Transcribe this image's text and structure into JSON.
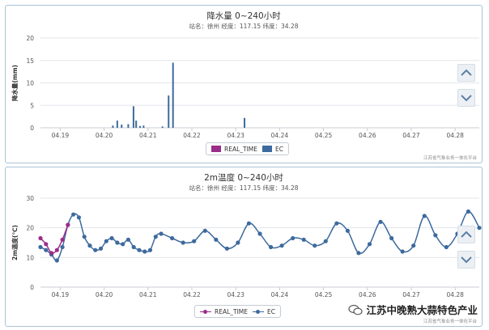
{
  "colors": {
    "ec": "#3d6a9e",
    "real_time": "#9b2d8a",
    "grid": "#e2e6ea",
    "axis_text": "#555555",
    "button_bg": "#ecf0f4",
    "button_icon": "#5b7fa6"
  },
  "x_ticks": [
    "04.19",
    "04.20",
    "04.21",
    "04.22",
    "04.23",
    "04.24",
    "04.25",
    "04.26",
    "04.27",
    "04.28"
  ],
  "legend": {
    "real_time": "REAL_TIME",
    "ec": "EC"
  },
  "credit": "江苏省气象业务一体化平台",
  "watermark": "江苏中晚熟大蒜特色产业",
  "nav": {
    "up_icon": "chevron-up-icon",
    "down_icon": "chevron-down-icon"
  },
  "chart_data": [
    {
      "type": "bar",
      "title": "降水量 0~240小时",
      "subtitle": "站名：徐州 经度：117.15 纬度：34.28",
      "ylabel": "降水量(mm)",
      "ylim": [
        0,
        20
      ],
      "yticks": [
        0,
        5,
        10,
        15,
        20
      ],
      "xlim_days": [
        0,
        10
      ],
      "x_tick_labels": [
        "04.19",
        "04.20",
        "04.21",
        "04.22",
        "04.23",
        "04.24",
        "04.25",
        "04.26",
        "04.27",
        "04.28"
      ],
      "series": [
        {
          "name": "EC",
          "x_days": [
            1.65,
            1.75,
            1.85,
            2.0,
            2.12,
            2.18,
            2.27,
            2.35,
            2.78,
            2.92,
            3.02,
            4.65
          ],
          "values": [
            0.5,
            1.6,
            0.7,
            0.8,
            4.8,
            1.6,
            0.4,
            0.5,
            0.3,
            7.2,
            14.5,
            2.2
          ]
        },
        {
          "name": "REAL_TIME",
          "x_days": [],
          "values": []
        }
      ]
    },
    {
      "type": "line",
      "title": "2m温度 0~240小时",
      "subtitle": "站名：徐州 经度：117.15 纬度：34.28",
      "ylabel": "2m温度(℃)",
      "ylim": [
        0,
        30
      ],
      "yticks": [
        0,
        10,
        20,
        30
      ],
      "xlim_days": [
        0,
        10
      ],
      "x_tick_labels": [
        "04.19",
        "04.20",
        "04.21",
        "04.22",
        "04.23",
        "04.24",
        "04.25",
        "04.26",
        "04.27",
        "04.28"
      ],
      "series": [
        {
          "name": "EC",
          "x_days": [
            0.0,
            0.125,
            0.25,
            0.375,
            0.5,
            0.625,
            0.75,
            0.875,
            1.0,
            1.125,
            1.25,
            1.375,
            1.5,
            1.625,
            1.75,
            1.875,
            2.0,
            2.125,
            2.25,
            2.375,
            2.5,
            2.625,
            2.75,
            3.0,
            3.25,
            3.5,
            3.75,
            4.0,
            4.25,
            4.5,
            4.75,
            5.0,
            5.25,
            5.5,
            5.75,
            6.0,
            6.25,
            6.5,
            6.75,
            7.0,
            7.25,
            7.5,
            7.75,
            8.0,
            8.25,
            8.5,
            8.75,
            9.0,
            9.25,
            9.5,
            9.75,
            10.0
          ],
          "values": [
            13.5,
            12.5,
            11.0,
            9.0,
            13.5,
            21.0,
            24.5,
            23.5,
            17.0,
            14.0,
            12.5,
            13.0,
            15.5,
            16.5,
            15.0,
            14.5,
            16.0,
            13.5,
            12.5,
            12.0,
            12.5,
            17.0,
            18.0,
            16.5,
            15.0,
            15.5,
            19.0,
            16.0,
            13.0,
            15.0,
            21.5,
            18.0,
            13.5,
            14.0,
            16.5,
            16.0,
            14.0,
            15.5,
            21.5,
            19.0,
            11.5,
            14.5,
            22.0,
            16.5,
            12.0,
            14.0,
            24.0,
            17.5,
            13.5,
            18.0,
            25.5,
            20.0
          ]
        },
        {
          "name": "REAL_TIME",
          "x_days": [
            0.0,
            0.125,
            0.25,
            0.375,
            0.5,
            0.625
          ],
          "values": [
            16.5,
            14.5,
            11.5,
            12.5,
            16.0,
            21.0
          ]
        }
      ]
    }
  ]
}
